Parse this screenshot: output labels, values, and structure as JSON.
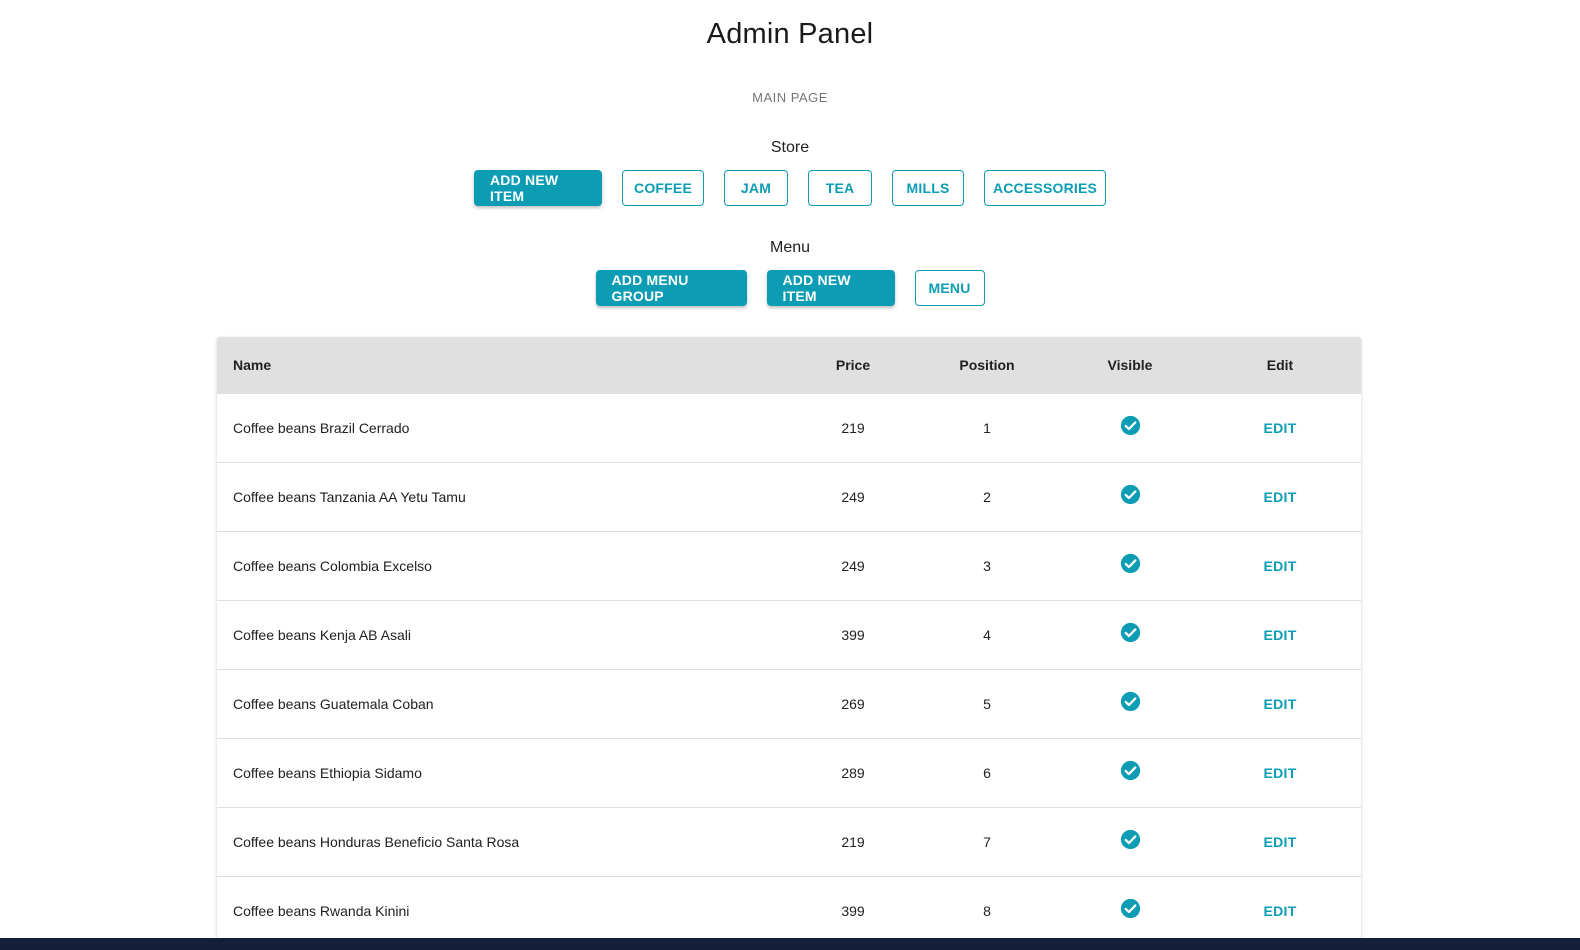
{
  "header": {
    "title": "Admin Panel",
    "main_link": "MAIN PAGE"
  },
  "store": {
    "label": "Store",
    "buttons": [
      "ADD NEW ITEM",
      "COFFEE",
      "JAM",
      "TEA",
      "MILLS",
      "ACCESSORIES"
    ]
  },
  "menu": {
    "label": "Menu",
    "buttons": [
      "ADD MENU GROUP",
      "ADD NEW ITEM",
      "MENU"
    ]
  },
  "table": {
    "columns": [
      "Name",
      "Price",
      "Position",
      "Visible",
      "Edit"
    ],
    "edit_label": "EDIT",
    "rows": [
      {
        "name": "Coffee beans Brazil Cerrado",
        "price": "219",
        "position": "1",
        "visible": true
      },
      {
        "name": "Coffee beans Tanzania AA Yetu Tamu",
        "price": "249",
        "position": "2",
        "visible": true
      },
      {
        "name": "Coffee beans Colombia Excelso",
        "price": "249",
        "position": "3",
        "visible": true
      },
      {
        "name": "Coffee beans Kenja AB Asali",
        "price": "399",
        "position": "4",
        "visible": true
      },
      {
        "name": "Coffee beans Guatemala Coban",
        "price": "269",
        "position": "5",
        "visible": true
      },
      {
        "name": "Coffee beans Ethiopia Sidamo",
        "price": "289",
        "position": "6",
        "visible": true
      },
      {
        "name": "Coffee beans Honduras Beneficio Santa Rosa",
        "price": "219",
        "position": "7",
        "visible": true
      },
      {
        "name": "Coffee beans Rwanda Kinini",
        "price": "399",
        "position": "8",
        "visible": true
      }
    ]
  },
  "colors": {
    "accent": "#0c9db4",
    "header_row": "#e0e0e0"
  },
  "icons": {
    "visible": "check-circle-icon"
  }
}
